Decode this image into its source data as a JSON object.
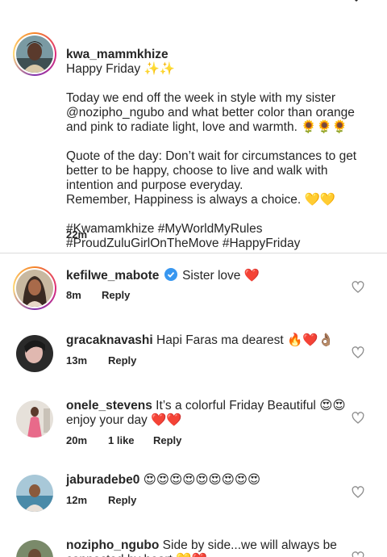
{
  "post": {
    "author": "kwa_mammkhize",
    "first_line": "Happy Friday ✨✨",
    "para1": "Today we end off the week in style with my sister @nozipho_ngubo and what better color than orange and pink to radiate light, love and warmth. 🌻🌻🌻",
    "para2": "Quote of the day: Don’t wait for circumstances to get better to be happy, choose to live and walk with intention and purpose everyday.\nRemember, Happiness is always a choice. 💛💛",
    "hashtags": "#Kwamamkhize  #MyWorldMyRules #ProudZuluGirlOnTheMove #HappyFriday",
    "time": "22m"
  },
  "comments": [
    {
      "user": "kefilwe_mabote",
      "text": "Sister love ❤️",
      "time": "8m",
      "likes": "",
      "reply": "Reply",
      "verified": true
    },
    {
      "user": "gracaknavashi",
      "text": "Hapi Faras ma dearest 🔥❤️👌🏽",
      "time": "13m",
      "likes": "",
      "reply": "Reply"
    },
    {
      "user": "onele_stevens",
      "text": "It’s a colorful Friday Beautiful 😍😍 enjoy your day ❤️❤️",
      "time": "20m",
      "likes": "1 like",
      "reply": "Reply"
    },
    {
      "user": "jaburadebe0",
      "text": "😍😍😍😍😍😍😍😍😍",
      "time": "12m",
      "likes": "",
      "reply": "Reply"
    },
    {
      "user": "nozipho_ngubo",
      "text": "Side by side...we will always be connected by heart 💛❤️"
    }
  ],
  "icons": {
    "like": "heart-outline-icon",
    "verified": "verified-badge-icon"
  },
  "colors": {
    "verified": "#3897f0",
    "text": "#262626",
    "divider": "#dbdbdb"
  }
}
